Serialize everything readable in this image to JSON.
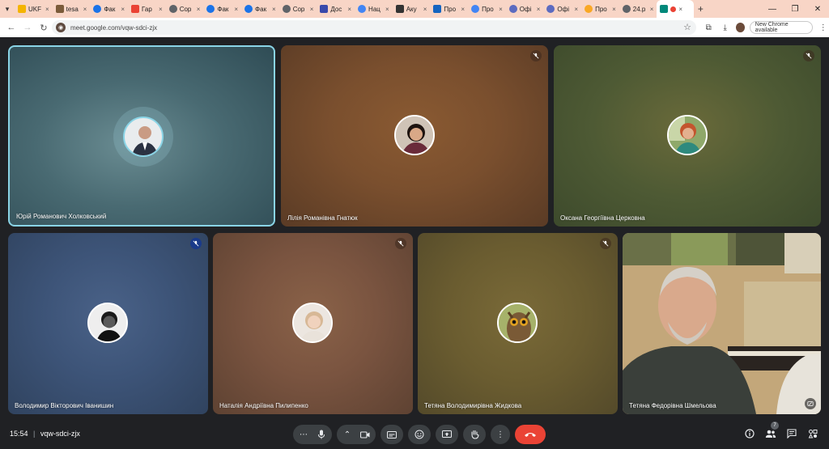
{
  "browser": {
    "tabs": [
      {
        "label": "UKF",
        "color": "#f4b400"
      },
      {
        "label": "tesa",
        "color": "#7b5b3a"
      },
      {
        "label": "Фак",
        "color": "#1a73e8"
      },
      {
        "label": "Гар",
        "color": "#ea4335"
      },
      {
        "label": "Сор",
        "color": "#5f6368"
      },
      {
        "label": "Фак",
        "color": "#1a73e8"
      },
      {
        "label": "Фак",
        "color": "#1a73e8"
      },
      {
        "label": "Сор",
        "color": "#5f6368"
      },
      {
        "label": "Дос",
        "color": "#3949ab"
      },
      {
        "label": "Нац",
        "color": "#4285f4"
      },
      {
        "label": "Аку",
        "color": "#333333"
      },
      {
        "label": "Про",
        "color": "#1565c0"
      },
      {
        "label": "Про",
        "color": "#4285f4"
      },
      {
        "label": "Офі",
        "color": "#5c6bc0"
      },
      {
        "label": "Офі",
        "color": "#5c6bc0"
      },
      {
        "label": "Про",
        "color": "#f9a825"
      },
      {
        "label": "24.р",
        "color": "#5f6368"
      }
    ],
    "url": "meet.google.com/vqw-sdci-zjx",
    "new_chrome_label": "New Chrome available"
  },
  "participants": [
    {
      "name": "Юрій Романович Холковський",
      "muted": false,
      "speaking": true
    },
    {
      "name": "Лілія Романівна Гнатюк",
      "muted": true
    },
    {
      "name": "Оксана Георгіївна Церковна",
      "muted": true
    },
    {
      "name": "Володимир Вікторович Іванишин",
      "muted": true
    },
    {
      "name": "Наталія Андріївна Пилипенко",
      "muted": true
    },
    {
      "name": "Тетяна Володимирівна Жидкова",
      "muted": true
    },
    {
      "name": "Тетяна Федорівна Шмельова",
      "muted": false,
      "video": true
    }
  ],
  "meeting": {
    "time": "15:54",
    "separator": "|",
    "code": "vqw-sdci-zjx",
    "participant_count": "7"
  }
}
